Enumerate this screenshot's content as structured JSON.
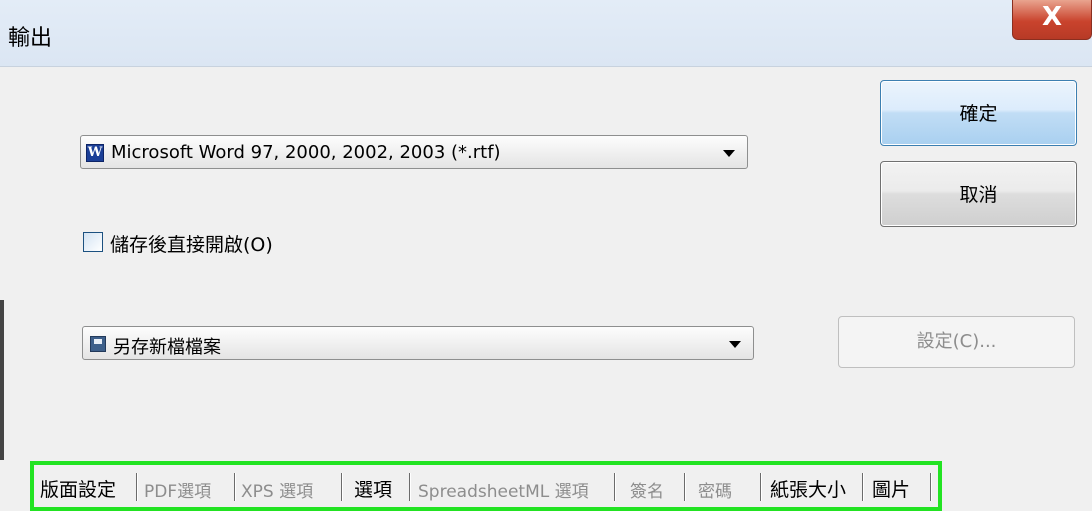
{
  "window": {
    "title": "輸出",
    "close_label": "X"
  },
  "format_select": {
    "value": "Microsoft Word 97, 2000, 2002, 2003 (*.rtf)",
    "icon": "word-icon",
    "icon_glyph": "W"
  },
  "open_after_save": {
    "label": "儲存後直接開啟(O)",
    "checked": false
  },
  "destination_select": {
    "value": "另存新檔檔案",
    "icon": "save-icon"
  },
  "buttons": {
    "ok": "確定",
    "cancel": "取消",
    "settings": "設定(C)..."
  },
  "tabs": [
    {
      "label": "版面設定",
      "enabled": true
    },
    {
      "label": "PDF選項",
      "enabled": false
    },
    {
      "label": "XPS 選項",
      "enabled": false
    },
    {
      "label": "選項",
      "enabled": true
    },
    {
      "label": "SpreadsheetML 選項",
      "enabled": false
    },
    {
      "label": "簽名",
      "enabled": false
    },
    {
      "label": "密碼",
      "enabled": false
    },
    {
      "label": "紙張大小",
      "enabled": true
    },
    {
      "label": "圖片",
      "enabled": true
    }
  ],
  "colors": {
    "highlight_border": "#22e322",
    "close_button": "#c9432d"
  }
}
